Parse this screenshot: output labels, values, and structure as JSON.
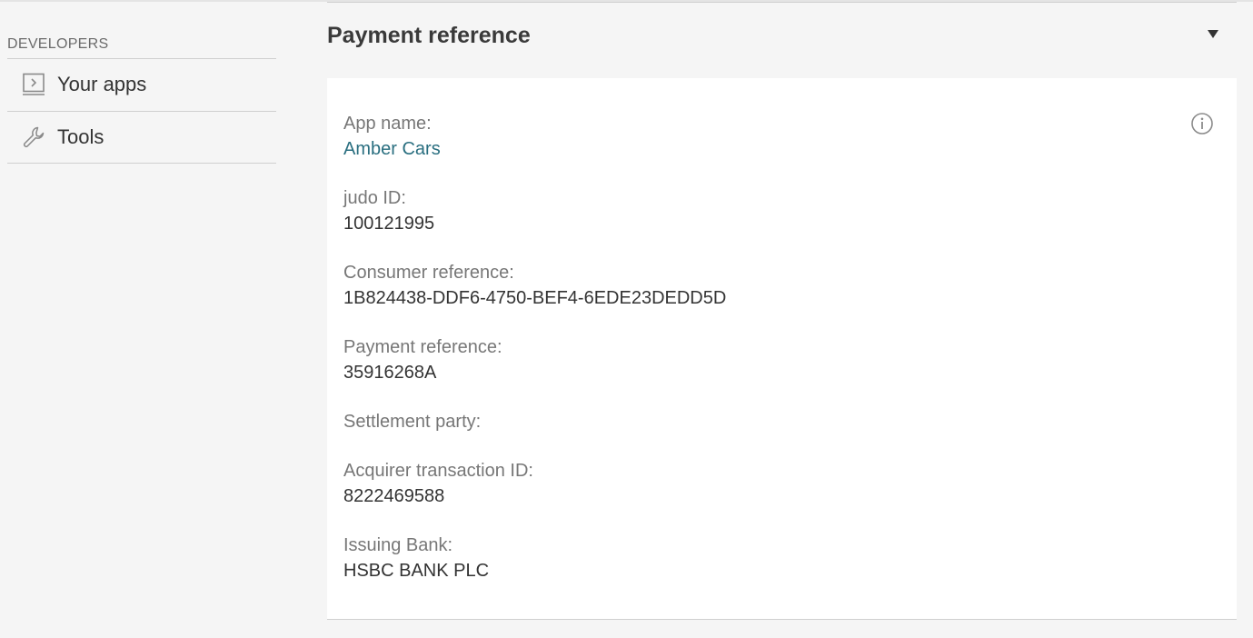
{
  "sidebar": {
    "section_title": "DEVELOPERS",
    "items": [
      {
        "label": "Your apps",
        "icon": "app-window-icon"
      },
      {
        "label": "Tools",
        "icon": "wrench-icon"
      }
    ]
  },
  "panel": {
    "title": "Payment reference",
    "fields": [
      {
        "label": "App name:",
        "value": "Amber Cars"
      },
      {
        "label": "judo ID:",
        "value": "100121995"
      },
      {
        "label": "Consumer reference:",
        "value": "1B824438-DDF6-4750-BEF4-6EDE23DEDD5D"
      },
      {
        "label": "Payment reference:",
        "value": "35916268A"
      },
      {
        "label": "Settlement party:",
        "value": ""
      },
      {
        "label": "Acquirer transaction ID:",
        "value": "8222469588"
      },
      {
        "label": "Issuing Bank:",
        "value": "HSBC BANK PLC"
      }
    ]
  },
  "colors": {
    "link": "#2a6f80",
    "label": "#777777",
    "background": "#f5f5f5",
    "panel": "#ffffff"
  }
}
